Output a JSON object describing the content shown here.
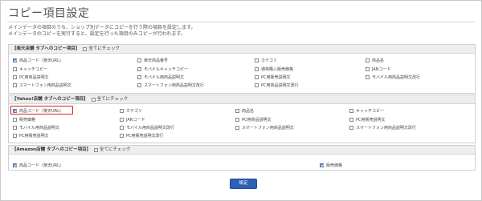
{
  "page": {
    "title": "コピー項目設定",
    "description_1": "メインデータの項目のうち、ショップ別データにコピーを行う際の項目を設定します。",
    "description_2": "メインデータのコピーを実行すると、設定を行った項目のみコピーが行われます。"
  },
  "sections": [
    {
      "header": "【楽天店舗 タブへのコピー項目】",
      "check_all_label": "全てにチェック",
      "items": [
        {
          "label": "商品コード（楽天URL)",
          "checked": true
        },
        {
          "label": "楽天商品番号",
          "checked": false
        },
        {
          "label": "カテゴリ",
          "checked": false
        },
        {
          "label": "商品名",
          "checked": false
        },
        {
          "label": "キャッチコピー",
          "checked": false
        },
        {
          "label": "モバイルキャッチコピー",
          "checked": false
        },
        {
          "label": "通常購入販売価格",
          "checked": false
        },
        {
          "label": "JANコード",
          "checked": false
        },
        {
          "label": "PC用商品説明文",
          "checked": false
        },
        {
          "label": "モバイル用商品説明文",
          "checked": false
        },
        {
          "label": "PC用販売説明文",
          "checked": false
        },
        {
          "label": "モバイル用商品説明文改行",
          "checked": false
        },
        {
          "label": "スマートフォン用商品説明文",
          "checked": false
        },
        {
          "label": "スマートフォン用商品説明文改行",
          "checked": false
        },
        {
          "label": "PC用商品説明文改行",
          "checked": false
        }
      ]
    },
    {
      "header": "【Yahoo!店舗 タブへのコピー項目】",
      "check_all_label": "全てにチェック",
      "items": [
        {
          "label": "商品コード（楽天URL)",
          "checked": true
        },
        {
          "label": "カテゴリ",
          "checked": false
        },
        {
          "label": "商品名",
          "checked": false
        },
        {
          "label": "キャッチコピー",
          "checked": false
        },
        {
          "label": "販売価格",
          "checked": false
        },
        {
          "label": "JANコード",
          "checked": false
        },
        {
          "label": "PC用商品説明文",
          "checked": false
        },
        {
          "label": "PC用販売説明文",
          "checked": false
        },
        {
          "label": "モバイル用商品説明文",
          "checked": false
        },
        {
          "label": "モバイル用商品説明文改行",
          "checked": false
        },
        {
          "label": "スマートフォン用商品説明文",
          "checked": false
        },
        {
          "label": "スマートフォン用商品説明文改行",
          "checked": false
        },
        {
          "label": "PC用販売説明文",
          "checked": false
        },
        {
          "label": "PC用販売説明文改行",
          "checked": false
        }
      ]
    },
    {
      "header": "【Amazon店舗 タブへのコピー項目】",
      "check_all_label": "全てにチェック",
      "items": [
        {
          "label": "商品コード（楽天URL)",
          "checked": true
        },
        {
          "label": "販売価格",
          "checked": true
        }
      ]
    }
  ],
  "footer": {
    "submit_label": "設定"
  },
  "colors": {
    "accent": "#2e5fb7",
    "highlight": "#e02020",
    "header_bg": "#eeeeee"
  }
}
